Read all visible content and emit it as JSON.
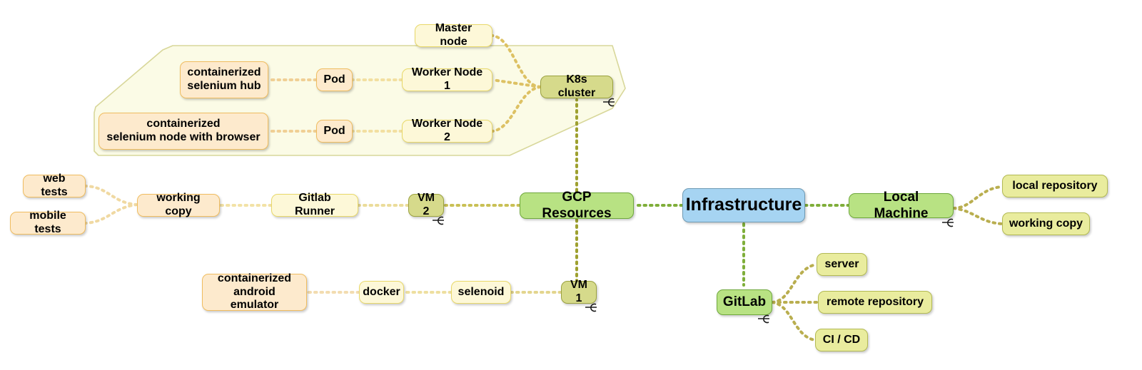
{
  "diagram": {
    "title": "Infrastructure mind map",
    "type": "mindmap",
    "palette": {
      "root_blue_fill": "#a6d4f2",
      "root_blue_border": "#6f9bb5",
      "green_fill": "#b8e283",
      "green_border": "#6fa83c",
      "khaki_fill": "#d6da8b",
      "khaki_border": "#9ba23f",
      "pale_yellow_fill": "#e9ec9e",
      "pale_yellow_border": "#b3ba53",
      "cream_fill": "#fdf8d8",
      "cream_border": "#e9d96a",
      "peach_fill": "#fdeacd",
      "peach_border": "#f0bd60",
      "group_fill": "#fbfbe6",
      "group_border": "#d8d79a",
      "edge_olive": "#9ea02f",
      "edge_green": "#7fae3a",
      "edge_gold": "#d9c45f",
      "edge_peach": "#eecb8e",
      "edge_cream": "#f0dfa6"
    },
    "nodes": {
      "infrastructure": {
        "label": "Infrastructure"
      },
      "gcp_resources": {
        "label": "GCP Resources"
      },
      "local_machine": {
        "label": "Local Machine",
        "collapsed": true
      },
      "gitlab": {
        "label": "GitLab",
        "collapsed": true
      },
      "k8s_cluster": {
        "label": "K8s cluster",
        "collapsed": true
      },
      "vm1": {
        "label": "VM 1",
        "collapsed": true
      },
      "vm2": {
        "label": "VM 2",
        "collapsed": true
      },
      "local_repository": {
        "label": "local repository"
      },
      "working_copy_right": {
        "label": "working copy"
      },
      "server": {
        "label": "server"
      },
      "remote_repository": {
        "label": "remote repository"
      },
      "ci_cd": {
        "label": "CI / CD"
      },
      "master_node": {
        "label": "Master node"
      },
      "worker_node_1": {
        "label": "Worker Node 1"
      },
      "worker_node_2": {
        "label": "Worker Node 2"
      },
      "pod_1": {
        "label": "Pod"
      },
      "pod_2": {
        "label": "Pod"
      },
      "containerized_selenium_hub": {
        "label": "containerized\nselenium hub"
      },
      "containerized_selenium_node": {
        "label": "containerized\nselenium node with browser"
      },
      "gitlab_runner": {
        "label": "Gitlab Runner"
      },
      "working_copy_left": {
        "label": "working copy"
      },
      "web_tests": {
        "label": "web tests"
      },
      "mobile_tests": {
        "label": "mobile tests"
      },
      "selenoid": {
        "label": "selenoid"
      },
      "docker": {
        "label": "docker"
      },
      "containerized_android_emulator": {
        "label": "containerized\nandroid emulator"
      }
    },
    "group": {
      "name": "k8s-cluster-group"
    },
    "icons": {
      "collapse": "collapse-handle-icon"
    }
  }
}
